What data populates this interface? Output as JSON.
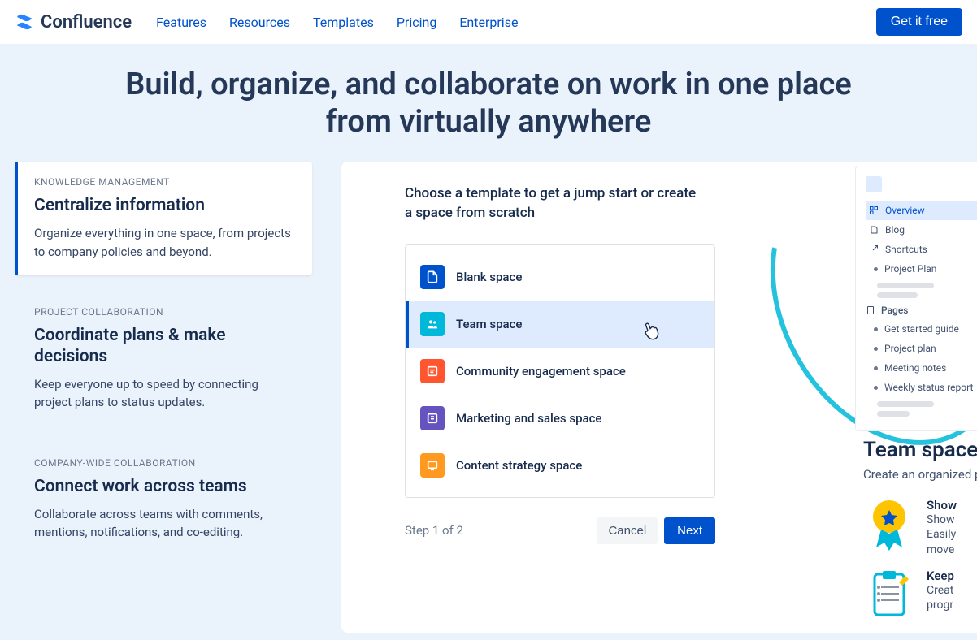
{
  "nav": {
    "brand": "Confluence",
    "links": [
      "Features",
      "Resources",
      "Templates",
      "Pricing",
      "Enterprise"
    ],
    "cta": "Get it free"
  },
  "hero": {
    "title": "Build, organize, and collaborate on work in one place from virtually anywhere"
  },
  "cards": [
    {
      "eyebrow": "KNOWLEDGE MANAGEMENT",
      "title": "Centralize information",
      "desc": "Organize everything in one space, from projects to company policies and beyond."
    },
    {
      "eyebrow": "PROJECT COLLABORATION",
      "title": "Coordinate plans & make decisions",
      "desc": "Keep everyone up to speed by connecting project plans to status updates."
    },
    {
      "eyebrow": "COMPANY-WIDE COLLABORATION",
      "title": "Connect work across teams",
      "desc": "Collaborate across teams with comments, mentions, notifications, and co-editing."
    }
  ],
  "preview": {
    "prompt": "Choose a template to get a jump start or create a space from scratch",
    "templates": [
      {
        "label": "Blank space",
        "color": "#0052CC"
      },
      {
        "label": "Team space",
        "color": "#00B8D9"
      },
      {
        "label": "Community engagement space",
        "color": "#FF5630"
      },
      {
        "label": "Marketing and sales space",
        "color": "#6554C0"
      },
      {
        "label": "Content strategy space",
        "color": "#FF991F"
      }
    ],
    "step": "Step 1 of 2",
    "cancel": "Cancel",
    "next": "Next"
  },
  "sidepanel": {
    "items": [
      "Overview",
      "Blog",
      "Shortcuts",
      "Project Plan"
    ],
    "pagesHeader": "Pages",
    "pages": [
      "Get started guide",
      "Project plan",
      "Meeting notes",
      "Weekly status report"
    ]
  },
  "teamspace": {
    "title": "Team space",
    "subtitle": "Create an organized place",
    "benefits": [
      {
        "title": "Show",
        "desc": "Show\nEasily\nmove"
      },
      {
        "title": "Keep",
        "desc": "Creat\nprogr"
      }
    ]
  }
}
